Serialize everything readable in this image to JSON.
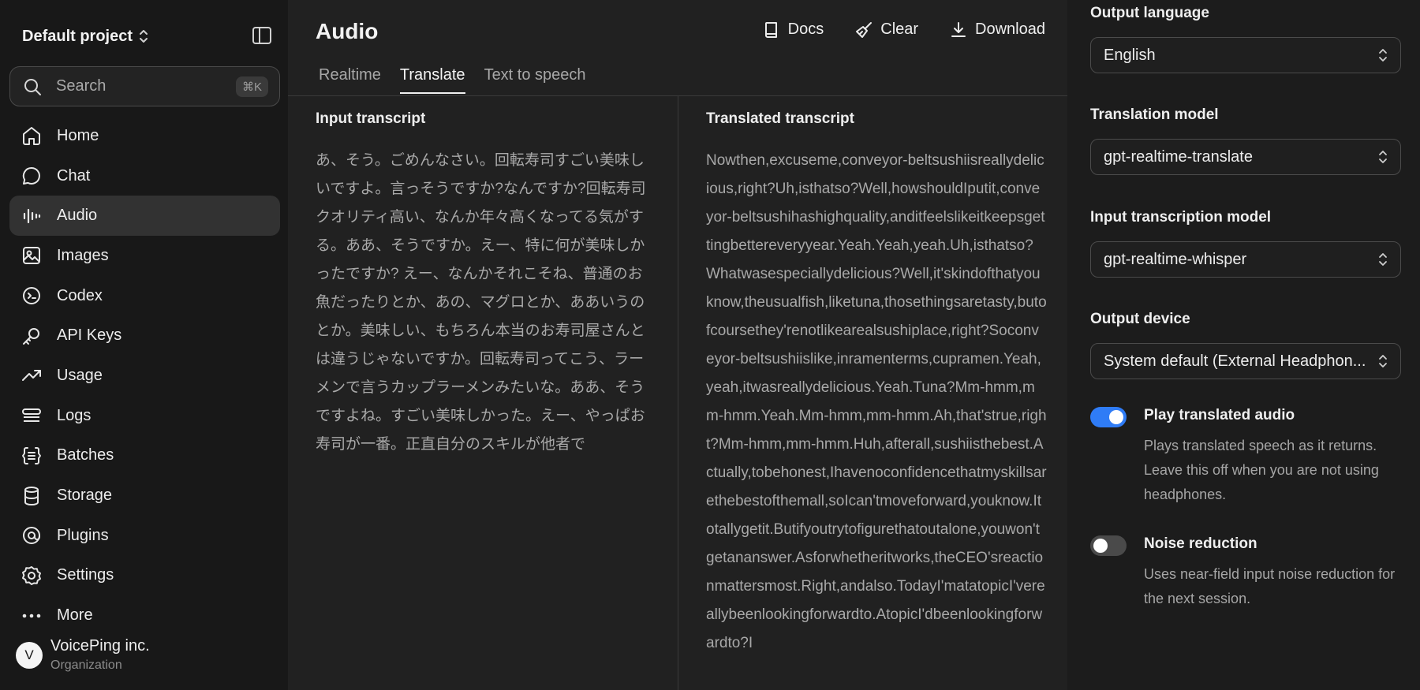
{
  "sidebar": {
    "project": "Default project",
    "search": {
      "placeholder": "Search",
      "shortcut": "⌘K"
    },
    "items": [
      {
        "label": "Home",
        "icon": "home-icon"
      },
      {
        "label": "Chat",
        "icon": "chat-icon"
      },
      {
        "label": "Audio",
        "icon": "audio-icon",
        "active": true
      },
      {
        "label": "Images",
        "icon": "image-icon"
      },
      {
        "label": "Codex",
        "icon": "codex-icon"
      },
      {
        "label": "API Keys",
        "icon": "key-icon"
      },
      {
        "label": "Usage",
        "icon": "trend-icon"
      },
      {
        "label": "Logs",
        "icon": "logs-icon"
      },
      {
        "label": "Batches",
        "icon": "batches-icon"
      },
      {
        "label": "Storage",
        "icon": "database-icon"
      },
      {
        "label": "Plugins",
        "icon": "plugin-icon"
      },
      {
        "label": "Settings",
        "icon": "gear-icon"
      },
      {
        "label": "More",
        "icon": "more-icon"
      }
    ],
    "org": {
      "initial": "V",
      "name": "VoicePing inc.",
      "type": "Organization"
    }
  },
  "main": {
    "title": "Audio",
    "actions": {
      "docs": "Docs",
      "clear": "Clear",
      "download": "Download"
    },
    "tabs": [
      {
        "label": "Realtime"
      },
      {
        "label": "Translate",
        "active": true
      },
      {
        "label": "Text to speech"
      }
    ],
    "input": {
      "title": "Input transcript",
      "text": "あ、そう。ごめんなさい。回転寿司すごい美味しいですよ。言っそうですか?なんですか?回転寿司クオリティ高い、なんか年々高くなってる気がする。ああ、そうですか。えー、特に何が美味しかったですか? えー、なんかそれこそね、普通のお魚だったりとか、あの、マグロとか、ああいうのとか。美味しい、もちろん本当のお寿司屋さんとは違うじゃないですか。回転寿司ってこう、ラーメンで言うカップラーメンみたいな。ああ、そうですよね。すごい美味しかった。えー、やっぱお寿司が一番。正直自分のスキルが他者で"
    },
    "output": {
      "title": "Translated transcript",
      "text": "Nowthen,excuseme,conveyor-beltsushiisreallydelicious,right?Uh,isthatso?Well,howshouldIputit,conveyor-beltsushihashighquality,anditfeelslikeitkeepsgettingbettereveryyear.Yeah.Yeah,yeah.Uh,isthatso?Whatwasespeciallydelicious?Well,it'skindofthatyouknow,theusualfish,liketuna,thosethingsaretasty,butofcoursethey'renotlikearealsushiplace,right?Soconveyor-beltsushiislike,inramenterms,cupramen.Yeah,yeah,itwasreallydelicious.Yeah.Tuna?Mm-hmm,mm-hmm.Yeah.Mm-hmm,mm-hmm.Ah,that'strue,right?Mm-hmm,mm-hmm.Huh,afterall,sushiisthebest.Actually,tobehonest,Ihavenoconfidencethatmyskillsarethebestofthemall,soIcan'tmoveforward,youknow.Itotallygetit.Butifyoutrytofigurethatoutalone,youwon'tgetananswer.Asforwhetheritworks,theCEO'sreactionmattersmost.Right,andalso.TodayI'matatopicI'vereallybeenlookingforwardto.AtopicI'dbeenlookingforwardto?I"
    }
  },
  "settings": {
    "output_language": {
      "label": "Output language",
      "value": "English"
    },
    "translation_model": {
      "label": "Translation model",
      "value": "gpt-realtime-translate"
    },
    "transcription_model": {
      "label": "Input transcription model",
      "value": "gpt-realtime-whisper"
    },
    "output_device": {
      "label": "Output device",
      "value": "System default (External Headphon..."
    },
    "play_audio": {
      "label": "Play translated audio",
      "description": "Plays translated speech as it returns. Leave this off when you are not using headphones.",
      "enabled": true
    },
    "noise_reduction": {
      "label": "Noise reduction",
      "description": "Uses near-field input noise reduction for the next session.",
      "enabled": false
    }
  },
  "colors": {
    "accent": "#2f7cf6",
    "sidebar": "#181818",
    "main": "#212121",
    "panel": "#1c1c1c"
  }
}
